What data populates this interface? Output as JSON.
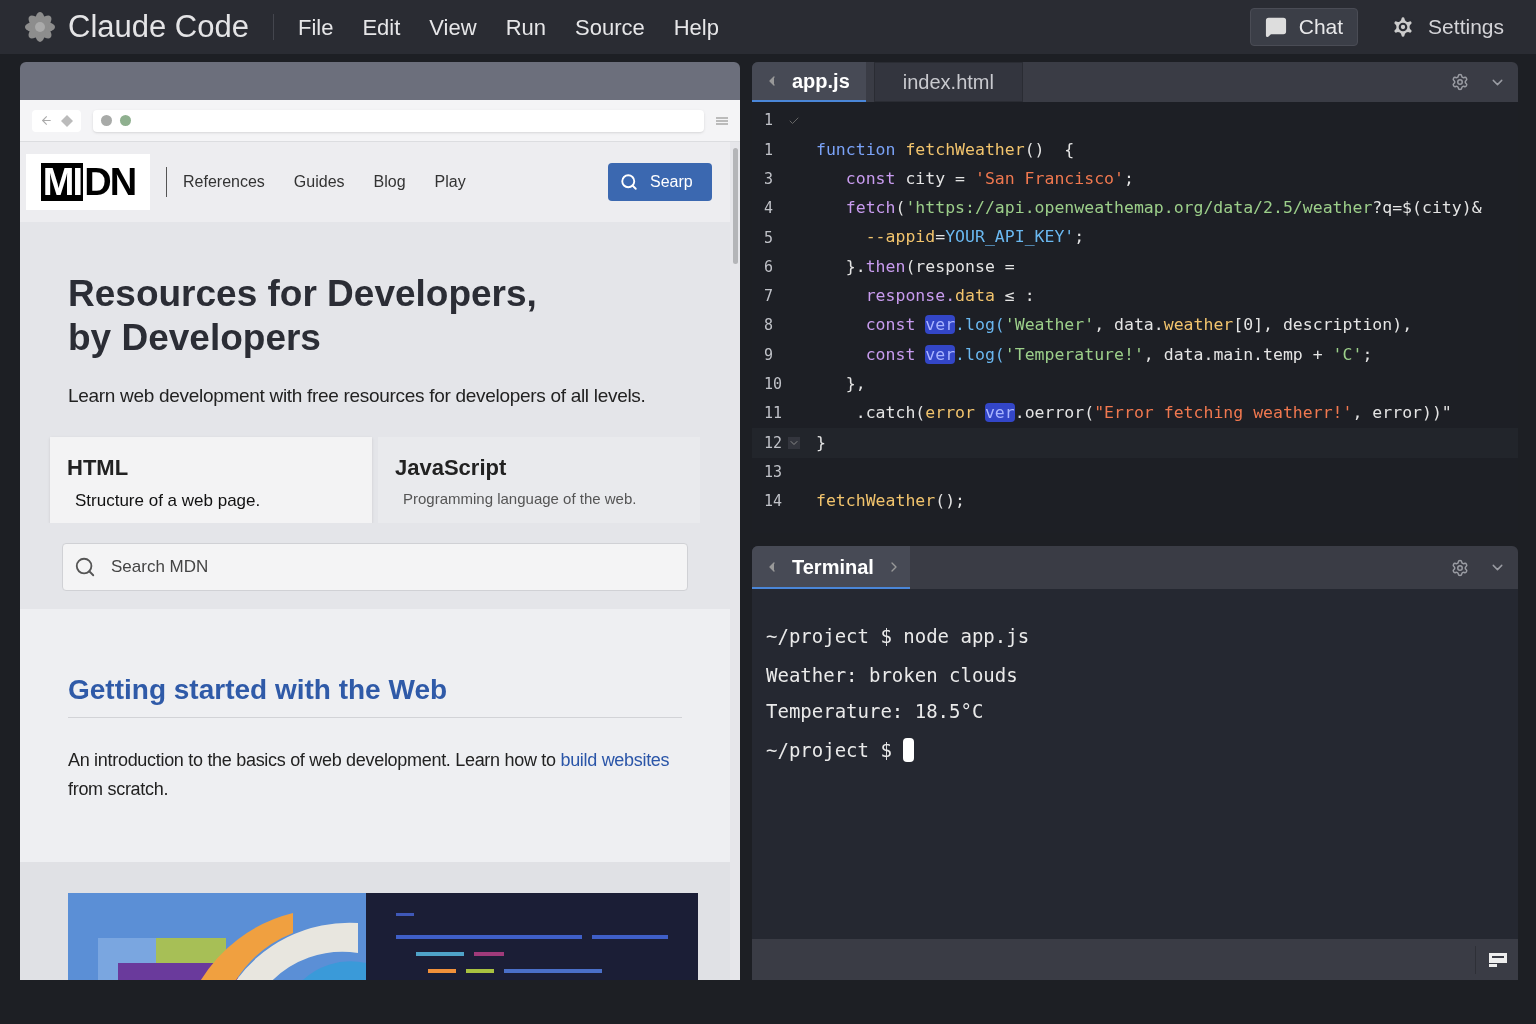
{
  "app": {
    "title": "Claude Code",
    "menu": [
      "File",
      "Edit",
      "View",
      "Run",
      "Source",
      "Help"
    ],
    "actions": [
      {
        "label": "Chat",
        "kind": "chat",
        "selected": true
      },
      {
        "label": "Settings",
        "kind": "settings",
        "selected": false
      }
    ]
  },
  "browser": {
    "logo": [
      "MI",
      "DN"
    ],
    "nav": [
      "References",
      "Guides",
      "Blog",
      "Play"
    ],
    "search_button": "Searp",
    "hero": {
      "title": "Resources for Developers, by Developers",
      "subtitle": "Learn web development with free resources for developers of all levels."
    },
    "cards": [
      {
        "title": "HTML",
        "description": "Structure of a web page.",
        "selected": true
      },
      {
        "title": "JavaScript",
        "description": "Programming language of the web.",
        "selected": false
      }
    ],
    "search": {
      "placeholder": "Search MDN"
    },
    "article": {
      "title": "Getting started with the Web",
      "body": "An introduction to the basics of web development. Learn how to ",
      "link": "build websites",
      "body_end": "from scratch."
    },
    "media": {
      "kind": "picture"
    }
  },
  "editor": {
    "tabs": [
      {
        "label": "app.js",
        "selected": true
      },
      {
        "label": "index.html",
        "selected": false
      }
    ],
    "lines": [
      {
        "number": "1",
        "kind": "check"
      },
      {
        "number": "1",
        "kind": "code",
        "tokens": [
          {
            "text": "function ",
            "kind": "keyword"
          },
          {
            "text": "fetchWeather",
            "kind": "function"
          },
          {
            "text": "()  {",
            "kind": "plain"
          }
        ]
      },
      {
        "number": "3",
        "kind": "code",
        "tokens": [
          {
            "text": "   const ",
            "kind": "storage"
          },
          {
            "text": "city = ",
            "kind": "plain"
          },
          {
            "text": "'San Francisco'",
            "kind": "string"
          },
          {
            "text": ";",
            "kind": "plain"
          }
        ]
      },
      {
        "number": "4",
        "kind": "code",
        "tokens": [
          {
            "text": "   fetch",
            "kind": "storage"
          },
          {
            "text": "(",
            "kind": "plain"
          },
          {
            "text": "'https://api.openweathemap.org/data/2.5/weather",
            "kind": "url"
          },
          {
            "text": "?q=$(city)&",
            "kind": "plain"
          }
        ]
      },
      {
        "number": "5",
        "kind": "code",
        "tokens": [
          {
            "text": "     --appid",
            "kind": "function"
          },
          {
            "text": "=",
            "kind": "plain"
          },
          {
            "text": "YOUR_API_KEY'",
            "kind": "constant"
          },
          {
            "text": ";",
            "kind": "plain"
          }
        ]
      },
      {
        "number": "6",
        "kind": "code",
        "tokens": [
          {
            "text": "   }.",
            "kind": "plain"
          },
          {
            "text": "then",
            "kind": "storage"
          },
          {
            "text": "(response =",
            "kind": "plain"
          }
        ]
      },
      {
        "number": "7",
        "kind": "code",
        "tokens": [
          {
            "text": "     response.",
            "kind": "storage"
          },
          {
            "text": "data",
            "kind": "function"
          },
          {
            "text": " ≤ :",
            "kind": "plain"
          }
        ]
      },
      {
        "number": "8",
        "kind": "code",
        "tokens": [
          {
            "text": "     const ",
            "kind": "storage"
          },
          {
            "text": "ver",
            "kind": "highlight"
          },
          {
            "text": ".log(",
            "kind": "constant"
          },
          {
            "text": "'Weather'",
            "kind": "url"
          },
          {
            "text": ", data.",
            "kind": "plain"
          },
          {
            "text": "weather",
            "kind": "function"
          },
          {
            "text": "[0], description),",
            "kind": "plain"
          }
        ]
      },
      {
        "number": "9",
        "kind": "code",
        "tokens": [
          {
            "text": "     const ",
            "kind": "storage"
          },
          {
            "text": "ver",
            "kind": "highlight"
          },
          {
            "text": ".log(",
            "kind": "constant"
          },
          {
            "text": "'Temperature!'",
            "kind": "url"
          },
          {
            "text": ", data.main.temp + ",
            "kind": "plain"
          },
          {
            "text": "'C'",
            "kind": "url"
          },
          {
            "text": ";",
            "kind": "plain"
          }
        ]
      },
      {
        "number": "10",
        "kind": "code",
        "tokens": [
          {
            "text": "   },",
            "kind": "plain"
          }
        ]
      },
      {
        "number": "11",
        "kind": "code",
        "tokens": [
          {
            "text": "    .catch(",
            "kind": "plain"
          },
          {
            "text": "error ",
            "kind": "function"
          },
          {
            "text": "ver",
            "kind": "highlight"
          },
          {
            "text": ".oerror(",
            "kind": "plain"
          },
          {
            "text": "\"Error fetching weatherr!'",
            "kind": "string"
          },
          {
            "text": ", error))\"",
            "kind": "plain"
          }
        ]
      },
      {
        "number": "12",
        "kind": "fold",
        "tokens": [
          {
            "text": "}",
            "kind": "plain"
          }
        ]
      },
      {
        "number": "13",
        "kind": "code"
      },
      {
        "number": "14",
        "kind": "code",
        "tokens": [
          {
            "text": "fetchWeather",
            "kind": "function"
          },
          {
            "text": "();",
            "kind": "plain"
          }
        ]
      }
    ]
  },
  "terminal": {
    "tab": {
      "label": "Terminal",
      "selected": true
    },
    "lines": [
      {
        "text": "~/project $ node app.js",
        "kind": "command"
      },
      {
        "text": "Weather: broken clouds",
        "kind": "output"
      },
      {
        "text": "Temperature: 18.5°C",
        "kind": "output"
      },
      {
        "text": "~/project $ ",
        "kind": "prompt",
        "cursor": true
      }
    ]
  }
}
